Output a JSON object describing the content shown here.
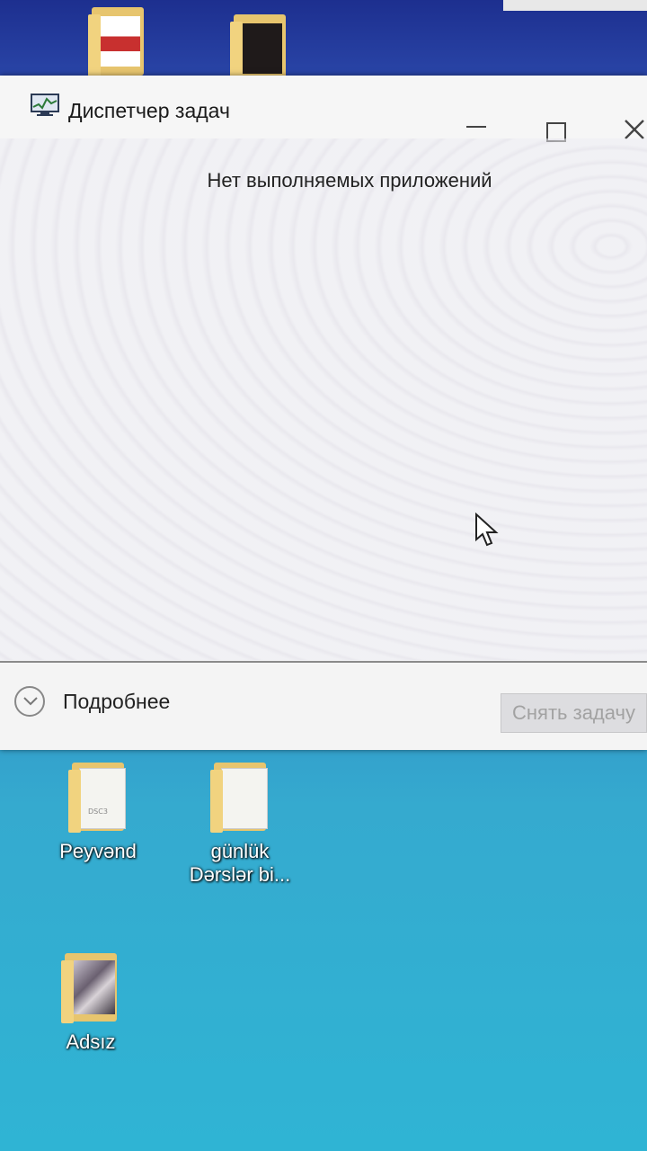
{
  "window": {
    "title": "Диспетчер задач",
    "empty_message": "Нет выполняемых приложений",
    "details_label": "Подробнее",
    "end_task_label": "Снять задачу"
  },
  "desktop": {
    "icons": [
      {
        "label": "Peyvənd",
        "icon": "folder-icon"
      },
      {
        "label_line1": "günlük",
        "label_line2": "Dərslər bi...",
        "icon": "folder-icon"
      },
      {
        "label": "Adsız",
        "icon": "folder-icon"
      }
    ],
    "colors": {
      "desktop_top": "#1d2f8f",
      "desktop_bottom": "#2fb4d4",
      "window_bg": "#f0f0f3"
    }
  }
}
